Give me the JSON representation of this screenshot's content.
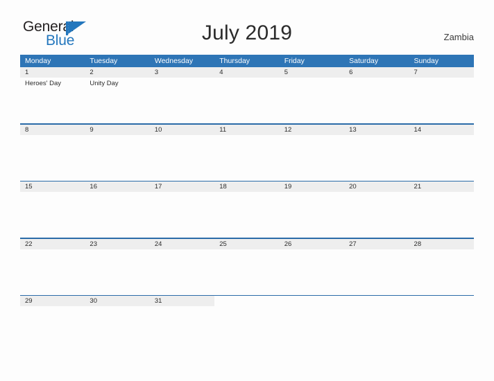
{
  "brand": {
    "line1": "General",
    "line2": "Blue",
    "triangle_icon": "triangle-flag-icon",
    "color_dark": "#231f20",
    "color_blue": "#2477bd"
  },
  "header": {
    "title": "July 2019",
    "region": "Zambia"
  },
  "calendar": {
    "accent_color": "#2e75b6",
    "band_color": "#eeeeee",
    "rule_color": "#2a6ba8",
    "weekdays": [
      "Monday",
      "Tuesday",
      "Wednesday",
      "Thursday",
      "Friday",
      "Saturday",
      "Sunday"
    ],
    "weeks": [
      {
        "days": [
          {
            "date": "1",
            "events": [
              "Heroes' Day"
            ]
          },
          {
            "date": "2",
            "events": [
              "Unity Day"
            ]
          },
          {
            "date": "3",
            "events": []
          },
          {
            "date": "4",
            "events": []
          },
          {
            "date": "5",
            "events": []
          },
          {
            "date": "6",
            "events": []
          },
          {
            "date": "7",
            "events": []
          }
        ]
      },
      {
        "days": [
          {
            "date": "8",
            "events": []
          },
          {
            "date": "9",
            "events": []
          },
          {
            "date": "10",
            "events": []
          },
          {
            "date": "11",
            "events": []
          },
          {
            "date": "12",
            "events": []
          },
          {
            "date": "13",
            "events": []
          },
          {
            "date": "14",
            "events": []
          }
        ]
      },
      {
        "days": [
          {
            "date": "15",
            "events": []
          },
          {
            "date": "16",
            "events": []
          },
          {
            "date": "17",
            "events": []
          },
          {
            "date": "18",
            "events": []
          },
          {
            "date": "19",
            "events": []
          },
          {
            "date": "20",
            "events": []
          },
          {
            "date": "21",
            "events": []
          }
        ]
      },
      {
        "days": [
          {
            "date": "22",
            "events": []
          },
          {
            "date": "23",
            "events": []
          },
          {
            "date": "24",
            "events": []
          },
          {
            "date": "25",
            "events": []
          },
          {
            "date": "26",
            "events": []
          },
          {
            "date": "27",
            "events": []
          },
          {
            "date": "28",
            "events": []
          }
        ]
      },
      {
        "days": [
          {
            "date": "29",
            "events": []
          },
          {
            "date": "30",
            "events": []
          },
          {
            "date": "31",
            "events": []
          },
          {
            "date": "",
            "events": []
          },
          {
            "date": "",
            "events": []
          },
          {
            "date": "",
            "events": []
          },
          {
            "date": "",
            "events": []
          }
        ]
      }
    ]
  }
}
